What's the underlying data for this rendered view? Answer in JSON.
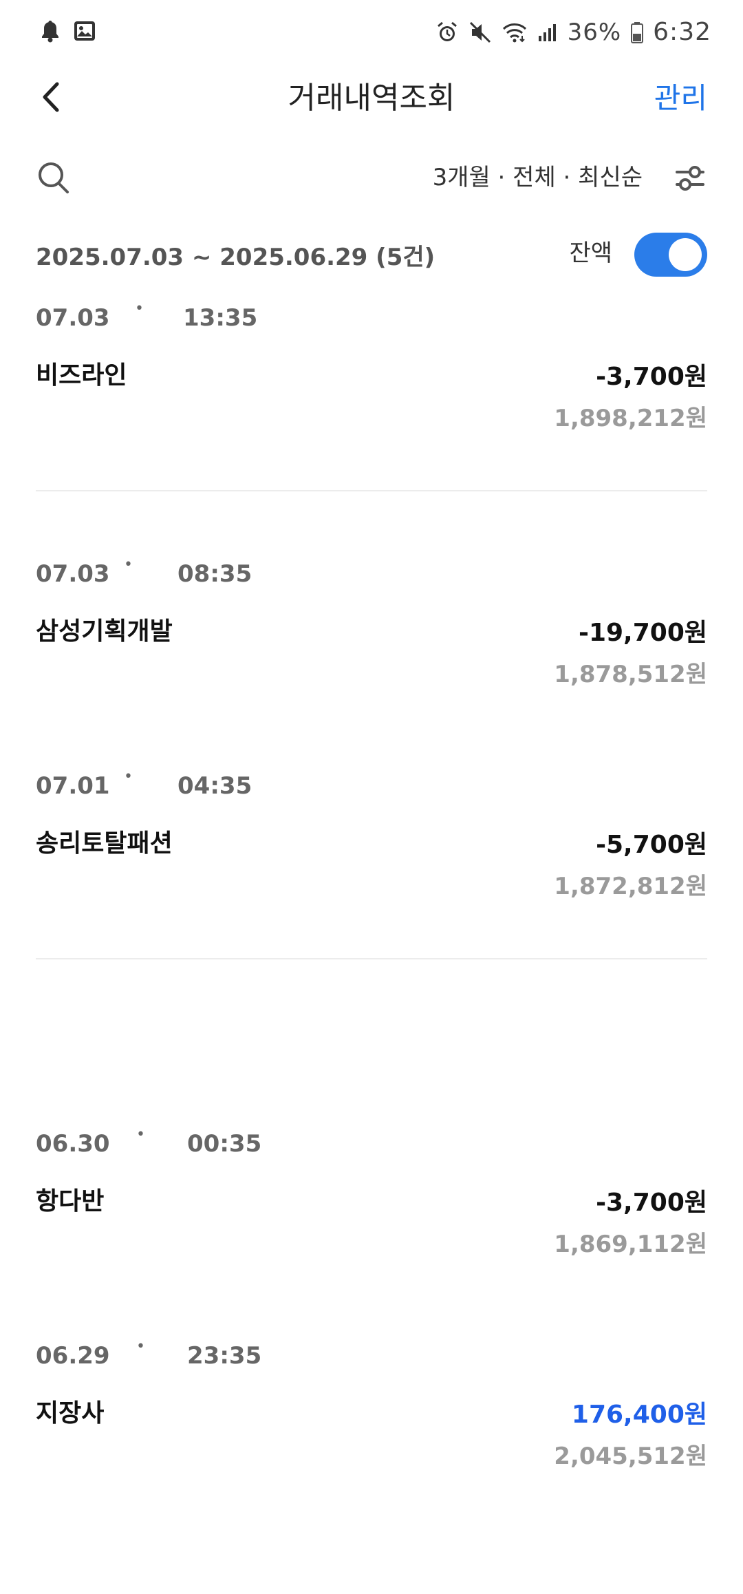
{
  "status_bar": {
    "left_icons": [
      "bell-icon",
      "image-icon"
    ],
    "right_icons": [
      "alarm-icon",
      "mute-icon",
      "wifi-icon",
      "signal-icon"
    ],
    "battery": "36%",
    "time": "6:32"
  },
  "header": {
    "back_icon": "chevron-left-icon",
    "title": "거래내역조회",
    "manage_label": "관리"
  },
  "filter": {
    "search_icon": "search-icon",
    "label": "3개월 · 전체 · 최신순",
    "settings_icon": "sliders-icon"
  },
  "period": {
    "range": "2025.07.03  ~  2025.06.29  (5건)",
    "balance_label": "잔액",
    "balance_toggle_on": true
  },
  "transactions": [
    {
      "date": "07.03",
      "time": "13:35",
      "name": "비즈라인",
      "amount": "-3,700원",
      "balance": "1,898,212원"
    },
    {
      "date": "07.03",
      "time": "08:35",
      "name": "삼성기획개발",
      "amount": "-19,700원",
      "balance": "1,878,512원"
    },
    {
      "date": "07.01",
      "time": "04:35",
      "name": "송리토탈패션",
      "amount": "-5,700원",
      "balance": "1,872,812원"
    },
    {
      "date": "06.30",
      "time": "00:35",
      "name": "항다반",
      "amount": "-3,700원",
      "balance": "1,869,112원"
    },
    {
      "date": "06.29",
      "time": "23:35",
      "name": "지장사",
      "amount": "176,400원",
      "balance": "2,045,512원"
    }
  ],
  "colors": {
    "accent": "#1f74e8",
    "deposit": "#1f5fe8",
    "toggle": "#2b7de9",
    "muted": "#9a9a9a"
  }
}
